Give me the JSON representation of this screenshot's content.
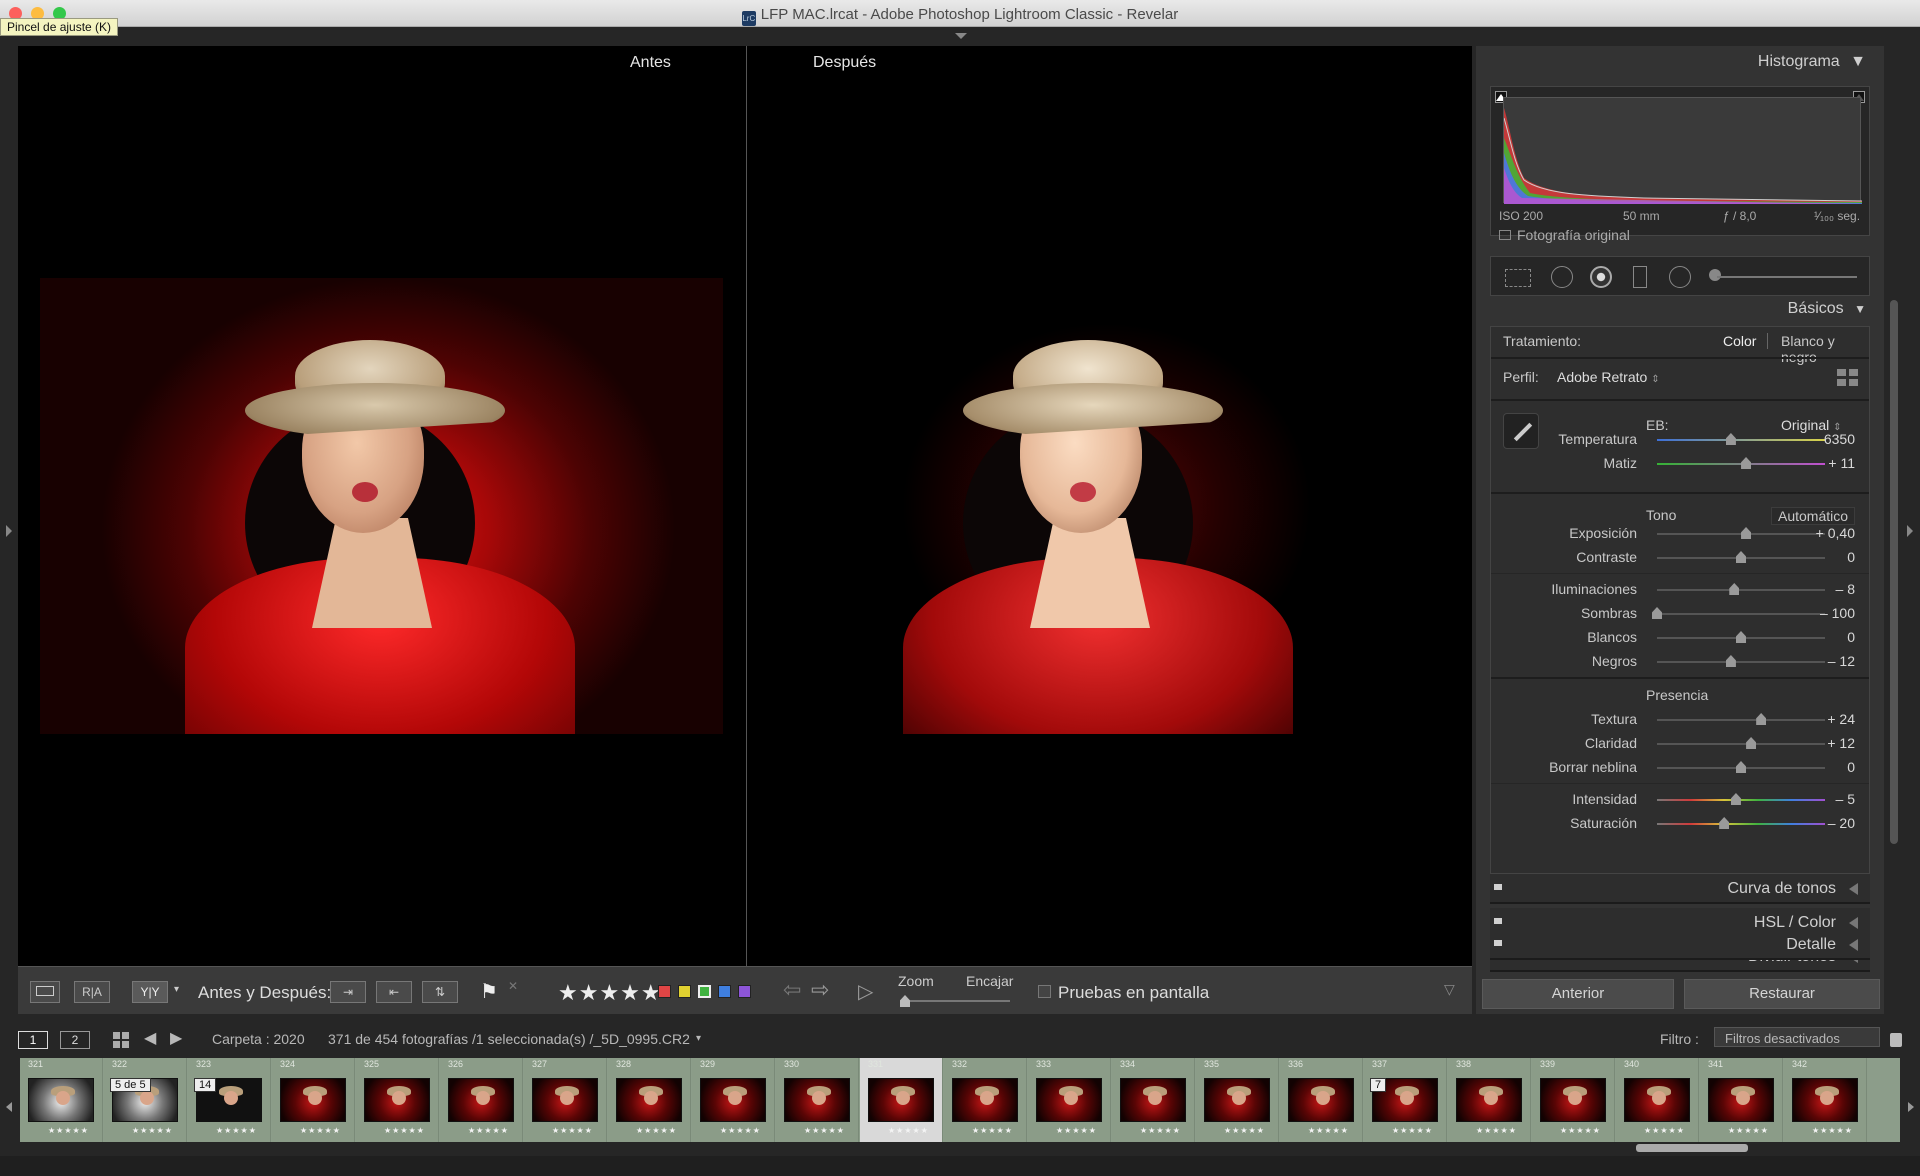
{
  "window": {
    "title": "LFP MAC.lrcat - Adobe Photoshop Lightroom Classic - Revelar",
    "app_badge": "LrC",
    "tooltip": "Pincel de ajuste (K)"
  },
  "view": {
    "before_label": "Antes",
    "after_label": "Después"
  },
  "toolbar": {
    "loupe_icon": "loupe-view-icon",
    "ra_label": "R|A",
    "yy_label": "Y|Y",
    "before_after_label": "Antes y Después:",
    "stars": "★★★★★",
    "color_labels": [
      "#e04545",
      "#e0d030",
      "#3fb23f",
      "#3f7fe0",
      "#8d55d8"
    ],
    "zoom_label": "Zoom",
    "fit_label": "Encajar",
    "soft_proof_label": "Pruebas en pantalla"
  },
  "histogram": {
    "title": "Histograma",
    "iso": "ISO 200",
    "focal": "50 mm",
    "aperture": "ƒ / 8,0",
    "shutter": "¹⁄₁₀₀ seg.",
    "original_photo_label": "Fotografía original"
  },
  "basic": {
    "title": "Básicos",
    "treatment_label": "Tratamiento:",
    "treatment_color": "Color",
    "treatment_bw": "Blanco y negro",
    "profile_label": "Perfil:",
    "profile_value": "Adobe Retrato",
    "wb_label": "EB:",
    "wb_value": "Original",
    "tone_label": "Tono",
    "auto_label": "Automático",
    "presence_label": "Presencia",
    "sliders": {
      "temp": {
        "label": "Temperatura",
        "value": "6350",
        "position": 0.44
      },
      "tint": {
        "label": "Matiz",
        "value": "+ 11",
        "position": 0.53
      },
      "exposure": {
        "label": "Exposición",
        "value": "+ 0,40",
        "position": 0.53
      },
      "contrast": {
        "label": "Contraste",
        "value": "0",
        "position": 0.5
      },
      "highlights": {
        "label": "Iluminaciones",
        "value": "– 8",
        "position": 0.46
      },
      "shadows": {
        "label": "Sombras",
        "value": "– 100",
        "position": 0.0
      },
      "whites": {
        "label": "Blancos",
        "value": "0",
        "position": 0.5
      },
      "blacks": {
        "label": "Negros",
        "value": "– 12",
        "position": 0.44
      },
      "texture": {
        "label": "Textura",
        "value": "+ 24",
        "position": 0.62
      },
      "clarity": {
        "label": "Claridad",
        "value": "+ 12",
        "position": 0.56
      },
      "dehaze": {
        "label": "Borrar neblina",
        "value": "0",
        "position": 0.5
      },
      "vibrance": {
        "label": "Intensidad",
        "value": "– 5",
        "position": 0.47
      },
      "saturation": {
        "label": "Saturación",
        "value": "– 20",
        "position": 0.4
      }
    }
  },
  "collapsed_panels": {
    "tone_curve": "Curva de tonos",
    "hsl": "HSL / Color",
    "split": "Dividir tonos",
    "detail": "Detalle"
  },
  "panel_buttons": {
    "previous": "Anterior",
    "reset": "Restaurar"
  },
  "filmstrip_header": {
    "monitor1": "1",
    "monitor2": "2",
    "folder": "Carpeta : 2020",
    "count": "371 de 454 fotografías /1 seleccionada(s) /_5D_0995.CR2",
    "filter_label": "Filtro :",
    "filter_value": "Filtros desactivados"
  },
  "filmstrip": {
    "numbers": [
      "321",
      "322",
      "323",
      "324",
      "325",
      "326",
      "327",
      "328",
      "329",
      "330",
      "331",
      "332",
      "333",
      "334",
      "335",
      "336",
      "337",
      "338",
      "339",
      "340",
      "341",
      "342"
    ],
    "stars": "★★★★★",
    "stack_badge_1": "5 de 5",
    "stack_badge_2": "14",
    "stack_badge_3": "7",
    "selected_number": "331"
  }
}
